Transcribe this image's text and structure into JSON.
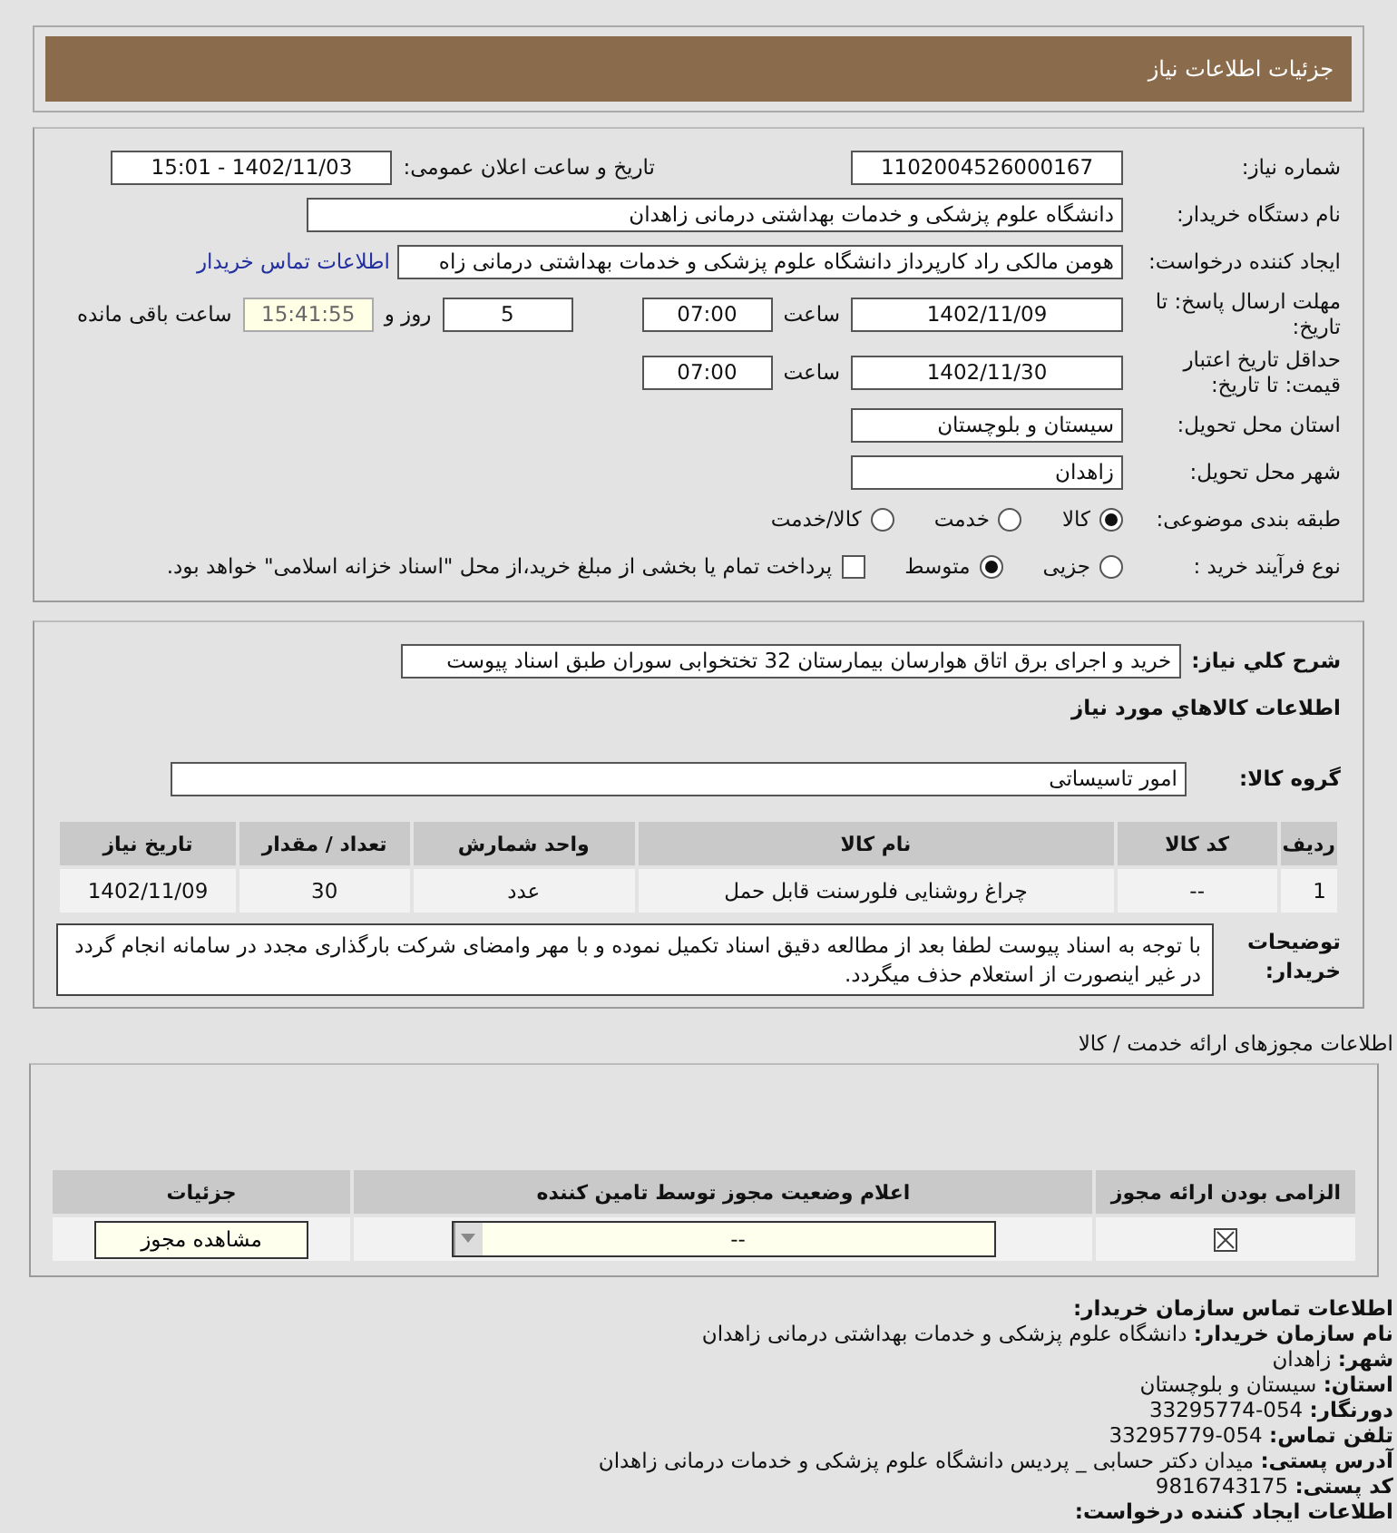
{
  "header": {
    "title": "جزئیات اطلاعات نیاز"
  },
  "form": {
    "need_number": {
      "label": "شماره نیاز:",
      "value": "1102004526000167"
    },
    "announce_datetime": {
      "label": "تاریخ و ساعت اعلان عمومی:",
      "value": "1402/11/03 - 15:01"
    },
    "buyer_org": {
      "label": "نام دستگاه خریدار:",
      "value": "دانشگاه علوم پزشکی و خدمات بهداشتی درمانی زاهدان"
    },
    "requester": {
      "label": "ایجاد کننده درخواست:",
      "value": "هومن  مالکی راد کارپرداز دانشگاه علوم پزشکی و خدمات بهداشتی درمانی زاه",
      "link": "اطلاعات تماس خریدار"
    },
    "reply_deadline": {
      "label": "مهلت ارسال پاسخ: تا تاریخ:",
      "date": "1402/11/09",
      "time_label": "ساعت",
      "time": "07:00",
      "days": "5",
      "days_label": "روز و",
      "remaining": "15:41:55",
      "remaining_label": "ساعت باقی مانده"
    },
    "price_validity": {
      "label": "حداقل تاریخ اعتبار قیمت: تا تاریخ:",
      "date": "1402/11/30",
      "time_label": "ساعت",
      "time": "07:00"
    },
    "province": {
      "label": "استان محل تحویل:",
      "value": "سیستان و بلوچستان"
    },
    "city": {
      "label": "شهر محل تحویل:",
      "value": "زاهدان"
    },
    "category": {
      "label": "طبقه بندی موضوعی:",
      "options": [
        {
          "label": "کالا",
          "selected": true
        },
        {
          "label": "خدمت",
          "selected": false
        },
        {
          "label": "کالا/خدمت",
          "selected": false
        }
      ]
    },
    "purchase_type": {
      "label": "نوع فرآیند خرید :",
      "options": [
        {
          "label": "جزیی",
          "selected": false
        },
        {
          "label": "متوسط",
          "selected": true
        }
      ],
      "treasury": {
        "label": "پرداخت تمام یا بخشی از مبلغ خرید،از محل \"اسناد خزانه اسلامی\" خواهد بود.",
        "checked": false
      }
    }
  },
  "need_summary": {
    "label": "شرح کلي نياز:",
    "value": "خرید و اجرای برق اتاق هوارسان بیمارستان 32 تختخوابی سوران طبق اسناد پیوست"
  },
  "goods_title": "اطلاعات کالاهاي مورد نياز",
  "goods_group": {
    "label": "گروه کالا:",
    "value": "امور تاسیساتی"
  },
  "items_table": {
    "columns": [
      "ردیف",
      "کد کالا",
      "نام کالا",
      "واحد شمارش",
      "تعداد / مقدار",
      "تاریخ نیاز"
    ],
    "rows": [
      [
        "1",
        "--",
        "چراغ روشنایی فلورسنت قابل حمل",
        "عدد",
        "30",
        "1402/11/09"
      ]
    ]
  },
  "buyer_notes": {
    "label": "توضیحات خریدار:",
    "value": "با توجه به اسناد پیوست لطفا بعد از مطالعه دقیق اسناد تکمیل نموده و با مهر وامضای شرکت بارگذاری مجدد در سامانه انجام گردد در غیر اینصورت از استعلام حذف میگردد."
  },
  "licenses": {
    "title": "اطلاعات مجوزهای ارائه خدمت / کالا",
    "columns": [
      "الزامی بودن ارائه مجوز",
      "اعلام وضعیت مجوز توسط تامین کننده",
      "جزئیات"
    ],
    "rows": [
      {
        "required": true,
        "status": "--",
        "details_button": "مشاهده مجوز"
      }
    ]
  },
  "contact": {
    "title": "اطلاعات تماس سازمان خریدار:",
    "lines": [
      {
        "label": "نام سازمان خریدار:",
        "value": "دانشگاه علوم پزشکی و خدمات بهداشتی درمانی زاهدان"
      },
      {
        "label": "شهر:",
        "value": "زاهدان"
      },
      {
        "label": "استان:",
        "value": "سیستان و بلوچستان"
      },
      {
        "label": "دورنگار:",
        "value": "054-33295774"
      },
      {
        "label": "تلفن تماس:",
        "value": "054-33295779"
      },
      {
        "label": "آدرس پستی:",
        "value": "میدان دکتر حسابی _ پردیس دانشگاه علوم پزشکی و خدمات درمانی زاهدان"
      },
      {
        "label": "کد پستی:",
        "value": "9816743175"
      }
    ],
    "next_title": "اطلاعات ایجاد کننده درخواست:"
  }
}
